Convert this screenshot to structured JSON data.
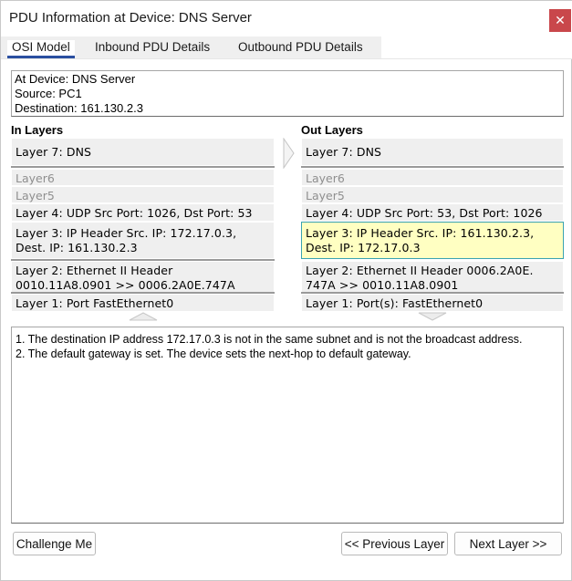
{
  "window": {
    "title": "PDU Information at Device: DNS Server",
    "close_label": "✕"
  },
  "tabs": [
    {
      "label": "OSI Model",
      "active": true
    },
    {
      "label": "Inbound PDU Details",
      "active": false
    },
    {
      "label": "Outbound PDU Details",
      "active": false
    }
  ],
  "info": {
    "device": "At Device: DNS Server",
    "source": "Source: PC1",
    "destination": "Destination: 161.130.2.3"
  },
  "in_layers": {
    "heading": "In Layers",
    "layer7": "Layer 7: DNS",
    "layer6": "Layer6",
    "layer5": "Layer5",
    "layer4": "Layer 4: UDP Src Port: 1026, Dst Port: 53",
    "layer3_line1": "Layer 3: IP Header Src. IP: 172.17.0.3,",
    "layer3_line2": "Dest. IP: 161.130.2.3",
    "layer2_line1": "Layer 2: Ethernet II Header",
    "layer2_line2": "0010.11A8.0901 >> 0006.2A0E.747A",
    "layer1": "Layer 1: Port FastEthernet0"
  },
  "out_layers": {
    "heading": "Out Layers",
    "layer7": "Layer 7: DNS",
    "layer6": "Layer6",
    "layer5": "Layer5",
    "layer4": "Layer 4: UDP Src Port: 53, Dst Port: 1026",
    "layer3_line1": "Layer 3: IP Header Src. IP: 161.130.2.3,",
    "layer3_line2": "Dest. IP: 172.17.0.3",
    "layer2_line1": "Layer 2: Ethernet II Header 0006.2A0E.",
    "layer2_line2": "747A >> 0010.11A8.0901",
    "layer1": "Layer 1: Port(s): FastEthernet0",
    "selected_layer": "Layer 3"
  },
  "description": {
    "line1": "1. The destination IP address 172.17.0.3 is not in the same subnet and is not the broadcast address.",
    "line2": "2. The default gateway is set. The device sets the next-hop to default gateway."
  },
  "buttons": {
    "challenge": "Challenge Me",
    "previous": "<< Previous Layer",
    "next": "Next Layer >>"
  },
  "colors": {
    "close_button": "#c9474b",
    "active_tab_underline": "#2a4fa0",
    "selected_layer_bg": "#ffffc2",
    "selected_layer_border": "#3aa3b0"
  }
}
